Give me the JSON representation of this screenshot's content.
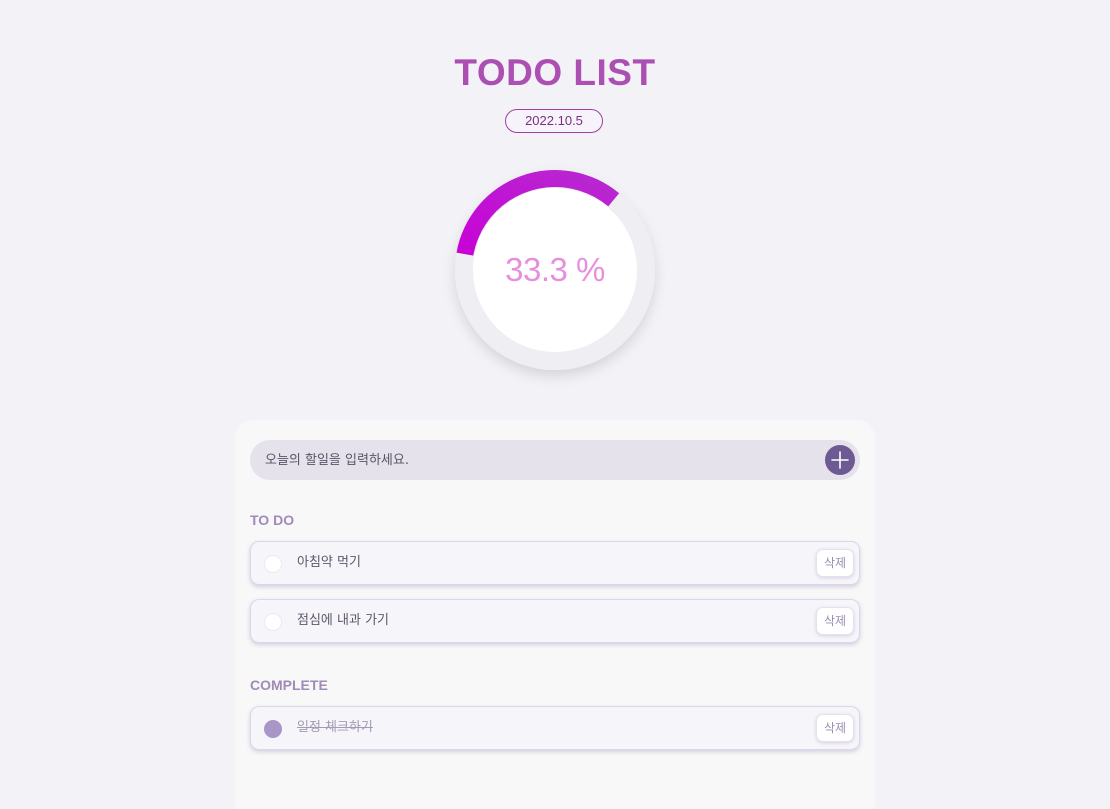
{
  "header": {
    "title": "TODO LIST",
    "date": "2022.10.5"
  },
  "progress": {
    "percent": 33.3,
    "label": "33.3 %",
    "gradient_start": "#c800d6",
    "gradient_end": "#b62cd0"
  },
  "input": {
    "placeholder": "오늘의 할일을 입력하세요.",
    "value": "",
    "add_icon": "plus-icon"
  },
  "todo": {
    "title": "TO DO",
    "items": [
      {
        "label": "아침약 먹기",
        "done": false,
        "delete_label": "삭제"
      },
      {
        "label": "점심에 내과 가기",
        "done": false,
        "delete_label": "삭제"
      }
    ]
  },
  "complete": {
    "title": "COMPLETE",
    "items": [
      {
        "label": "일정 체크하기",
        "done": true,
        "delete_label": "삭제"
      }
    ]
  },
  "colors": {
    "accent": "#ab4fb3",
    "badge_border": "#a23fa0",
    "add_button": "#6d5a92",
    "section_title": "#a08bb8",
    "checked": "#a897c6",
    "background": "#f3f2f7"
  }
}
